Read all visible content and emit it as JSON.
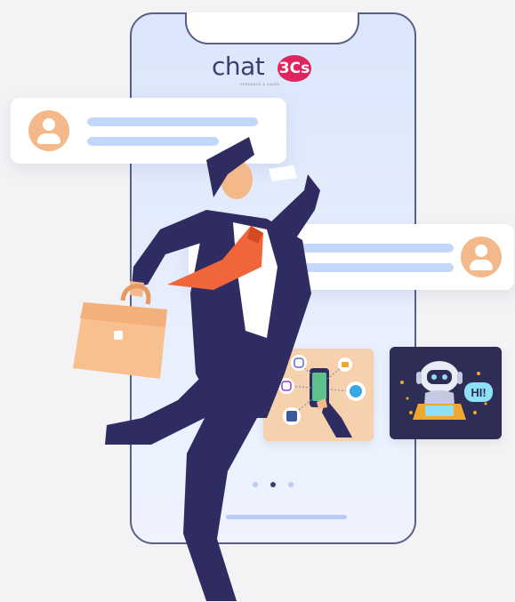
{
  "brand": {
    "logo_word": "chat",
    "logo_badge": "3Cs",
    "logo_tagline": "FEEDBACK & SALES"
  },
  "bot_card": {
    "greeting": "HI!"
  },
  "carousel": {
    "page_count": 3,
    "active_index": 1
  },
  "colors": {
    "phone_outline": "#5a5f86",
    "phone_screen": "#dbe6fb",
    "avatar": "#f4b98a",
    "text_bar": "#c3d6fb",
    "suit": "#2f2c62",
    "tie": "#f0653a",
    "briefcase": "#f7c08e",
    "bot_bg": "#2d2d55",
    "social_bg": "#f6d1ad",
    "brand_accent": "#e0245e"
  },
  "icons": {
    "user": "user-avatar-icon",
    "briefcase": "briefcase-icon",
    "social": [
      "facebook-icon",
      "twitter-icon",
      "instagram-icon",
      "message-icon"
    ],
    "bot": "chatbot-icon"
  }
}
